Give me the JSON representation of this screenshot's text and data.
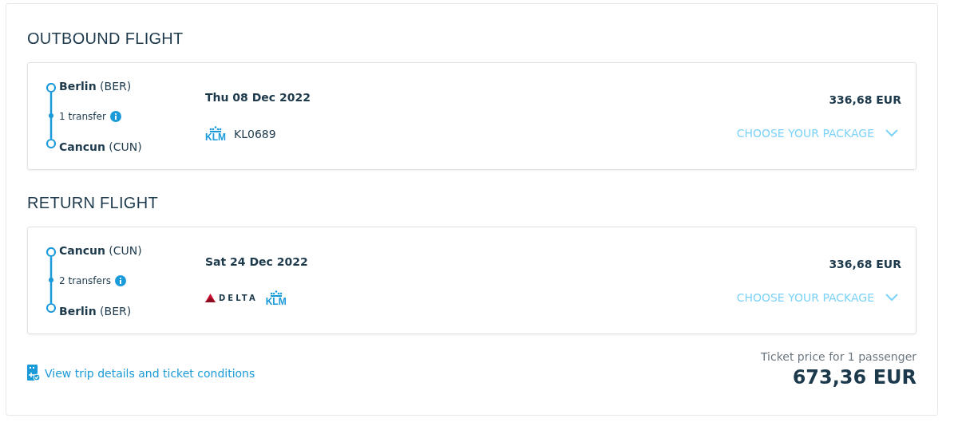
{
  "sections": [
    {
      "heading": "OUTBOUND FLIGHT",
      "from": {
        "city": "Berlin",
        "code": "(BER)"
      },
      "transfers": "1 transfer",
      "to": {
        "city": "Cancun",
        "code": "(CUN)"
      },
      "date": "Thu 08 Dec 2022",
      "airlines": [
        {
          "kind": "klm",
          "name": "KLM"
        }
      ],
      "flight_number": "KL0689",
      "price": "336,68 EUR",
      "package": "CHOOSE YOUR PACKAGE"
    },
    {
      "heading": "RETURN FLIGHT",
      "from": {
        "city": "Cancun",
        "code": "(CUN)"
      },
      "transfers": "2 transfers",
      "to": {
        "city": "Berlin",
        "code": "(BER)"
      },
      "date": "Sat 24 Dec 2022",
      "airlines": [
        {
          "kind": "delta",
          "name": "DELTA"
        },
        {
          "kind": "klm",
          "name": "KLM"
        }
      ],
      "price": "336,68 EUR",
      "package": "CHOOSE YOUR PACKAGE"
    }
  ],
  "details_link": "View trip details and ticket conditions",
  "total": {
    "label": "Ticket price for 1 passenger",
    "amount": "673,36 EUR"
  }
}
